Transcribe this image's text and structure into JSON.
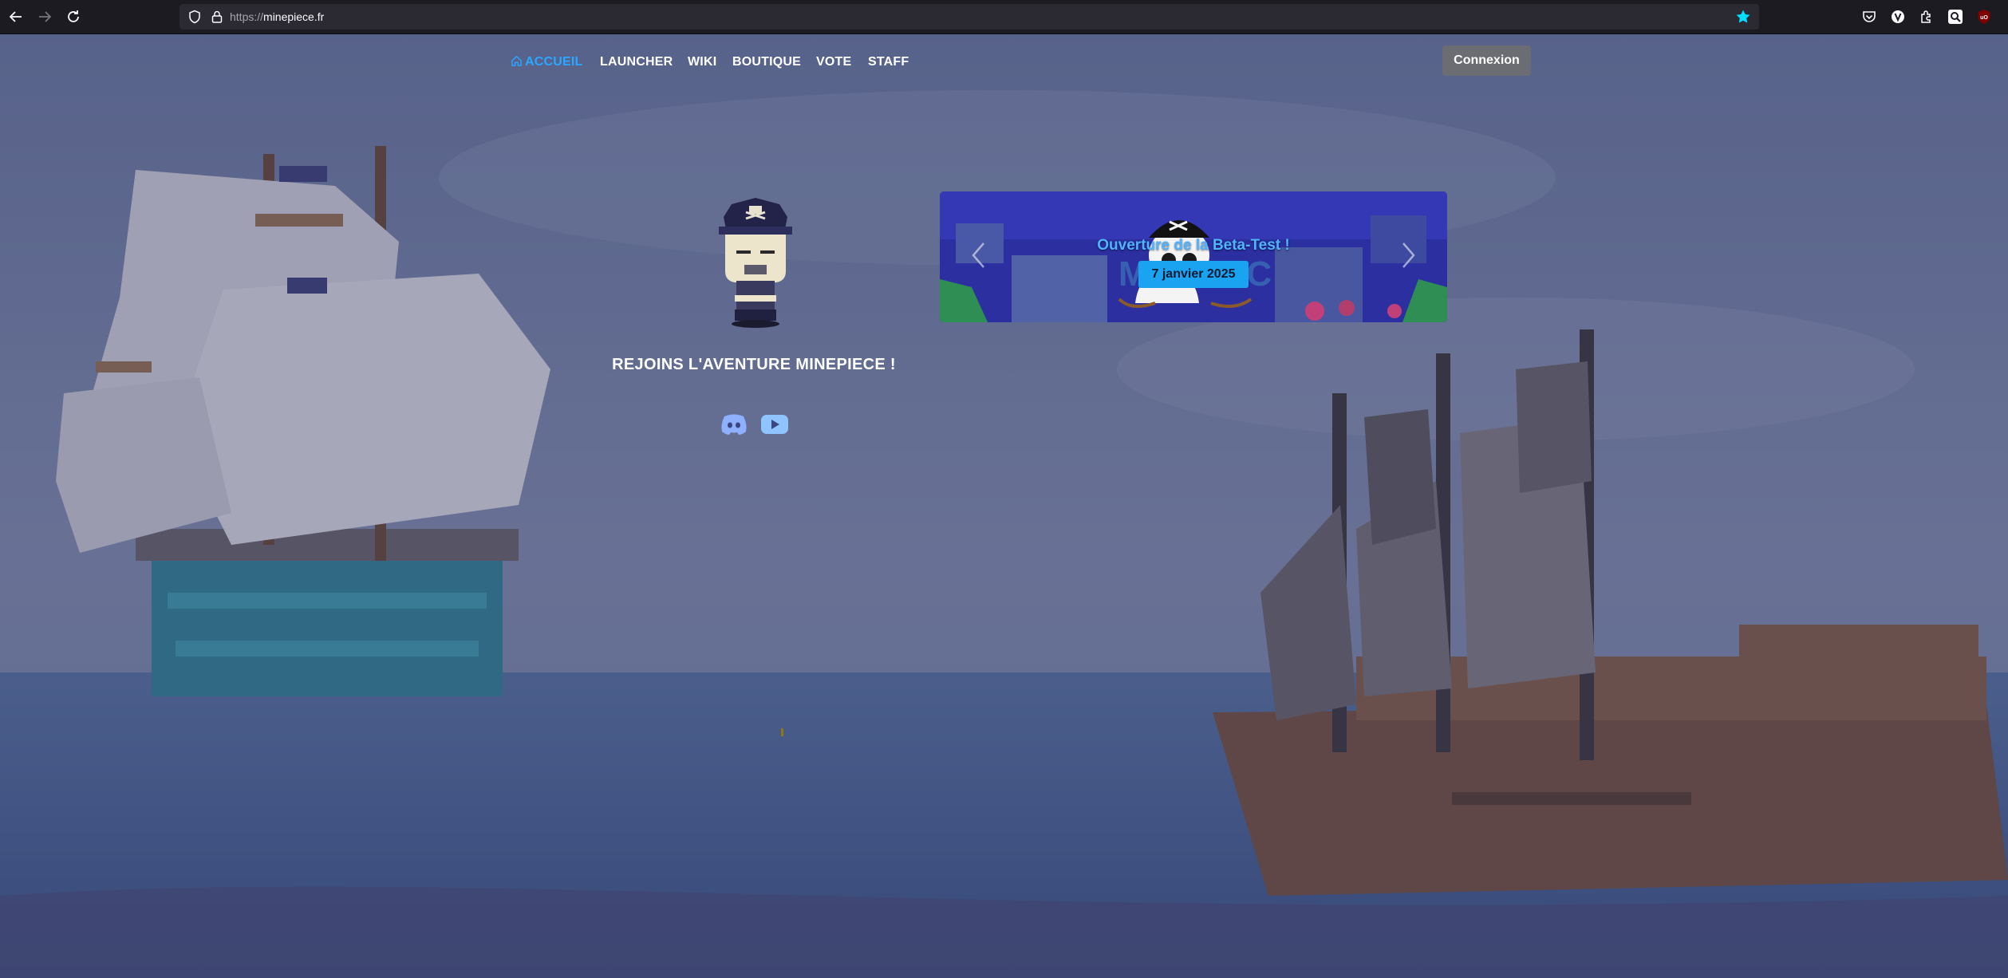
{
  "browser": {
    "url_scheme": "https://",
    "url_host": "minepiece.fr"
  },
  "nav": {
    "items": [
      {
        "label": "ACCUEIL",
        "active": true
      },
      {
        "label": "LAUNCHER",
        "active": false
      },
      {
        "label": "WIKI",
        "active": false
      },
      {
        "label": "BOUTIQUE",
        "active": false
      },
      {
        "label": "VOTE",
        "active": false
      },
      {
        "label": "STAFF",
        "active": false
      }
    ],
    "login_label": "Connexion"
  },
  "hero": {
    "tagline": "REJOINS L'AVENTURE MINEPIECE !",
    "socials": [
      "discord-icon",
      "youtube-icon"
    ]
  },
  "carousel": {
    "slide_title": "Ouverture de la Beta-Test !",
    "slide_date": "7 janvier 2025"
  },
  "colors": {
    "accent": "#2aa8ff",
    "browser_bg": "#1c1b22",
    "url_field": "#2b2a33",
    "login_button": "#6b6d72",
    "date_badge": "#1aa3f0"
  }
}
